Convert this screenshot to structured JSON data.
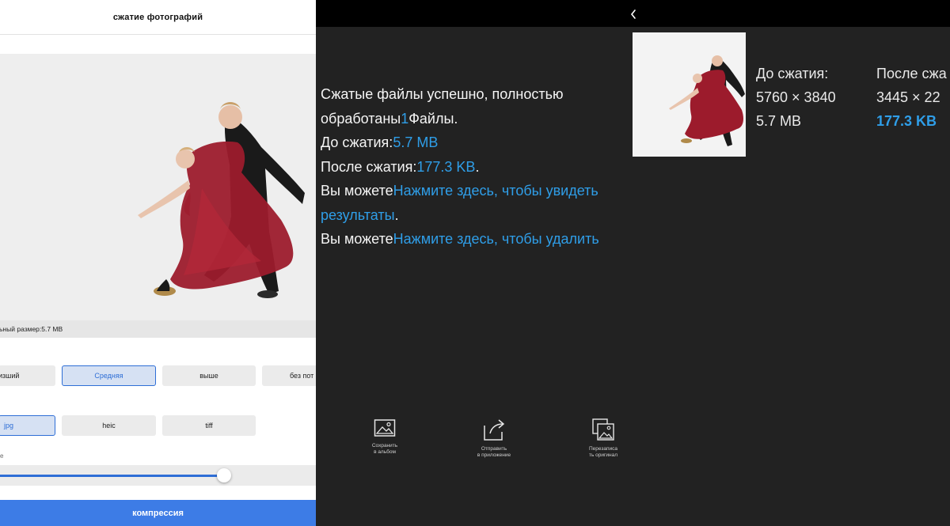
{
  "left_panel": {
    "title": "сжатие фотографий",
    "original_size": "ьный размер:5.7 MB",
    "quality_options": [
      {
        "label": "изший",
        "selected": false
      },
      {
        "label": "Средняя",
        "selected": true
      },
      {
        "label": "выше",
        "selected": false
      },
      {
        "label": "без пот",
        "selected": false
      }
    ],
    "format_options": [
      {
        "label": "jpg",
        "selected": true
      },
      {
        "label": "heic",
        "selected": false
      },
      {
        "label": "tiff",
        "selected": false
      }
    ],
    "slider": {
      "label": "e",
      "value_fraction": 0.71
    },
    "compress_button": "компрессия"
  },
  "right_panel": {
    "message": {
      "line1": "Сжатые файлы успешно, полностью",
      "line2_prefix": "обработаны",
      "line2_count": "1",
      "line2_suffix": "Файлы.",
      "before_label": "До сжатия:",
      "before_value": "5.7 MB",
      "after_label": "После сжатия:",
      "after_value": "177.3 KB",
      "you_can_1": " Вы можете",
      "view_link": "Нажмите здесь, чтобы увидеть",
      "view_link_2": "результаты",
      "view_link_end": ".",
      "you_can_2": " Вы можете",
      "delete_link": "Нажмите здесь, чтобы удалить"
    },
    "before": {
      "label": "До сжатия:",
      "dimensions": "5760 × 3840",
      "size": "5.7 MB"
    },
    "after": {
      "label": "После сжа",
      "dimensions": "3445 × 22",
      "size": "177.3 KB"
    },
    "actions": [
      {
        "icon": "image-icon",
        "label_line1": "Сохранить",
        "label_line2": "в альбом"
      },
      {
        "icon": "share-icon",
        "label_line1": "Отправить",
        "label_line2": "в приложение"
      },
      {
        "icon": "photos-icon",
        "label_line1": "Перезаписа",
        "label_line2": "ть оригинал"
      }
    ]
  },
  "colors": {
    "accent_blue": "#2f9ee8",
    "button_blue": "#3d7ce6",
    "dark_bg": "#222222",
    "dress_red": "#9c1b2c"
  }
}
